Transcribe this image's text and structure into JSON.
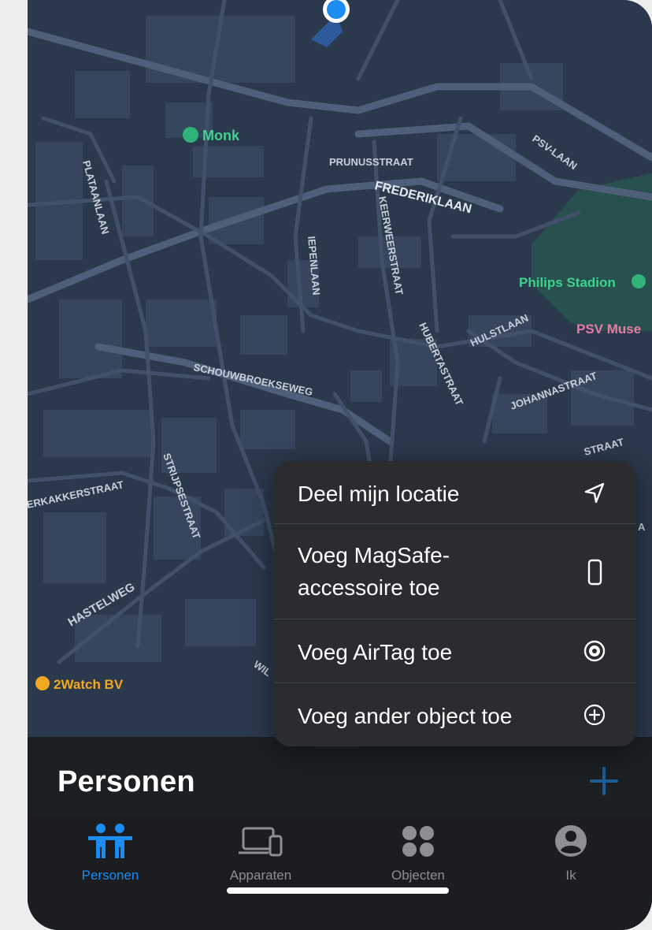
{
  "map": {
    "pois": {
      "monk": "Monk",
      "philips_stadion": "Philips Stadion",
      "psv_museum": "PSV Muse",
      "twowatch": "2Watch BV"
    },
    "streets": {
      "prunusstraat": "PRUNUSSTRAAT",
      "frederiklaan": "FREDERIKLAAN",
      "psv_laan": "PSV-LAAN",
      "plataanlaan": "PLATAANLAAN",
      "keerweerstraat": "KEERWEERSTRAAT",
      "iepenlaan": "IEPENLAAN",
      "hulstlaan": "HULSTLAAN",
      "hubertastraat": "HUBERTASTRAAT",
      "johannastraat": "JOHANNASTRAAT",
      "schouwbroekseweg": "SCHOUWBROEKSEWEG",
      "strijpsestraat": "STRIJPSESTRAAT",
      "akkerstraat": "ERKAKKERSTRAAT",
      "hastelweg": "HASTELWEG",
      "straat_right": "STRAAT",
      "wil": "WIL",
      "a_right": "A"
    }
  },
  "menu": {
    "items": [
      {
        "line1": "Deel mijn locatie",
        "line2": "",
        "icon": "location-arrow-icon"
      },
      {
        "line1": "Voeg MagSafe-",
        "line2": "accessoire toe",
        "icon": "phone-icon"
      },
      {
        "line1": "Voeg AirTag toe",
        "line2": "",
        "icon": "airtag-icon"
      },
      {
        "line1": "Voeg ander object toe",
        "line2": "",
        "icon": "plus-circle-icon"
      }
    ]
  },
  "sheet": {
    "title": "Personen"
  },
  "tabs": [
    {
      "label": "Personen",
      "active": true
    },
    {
      "label": "Apparaten",
      "active": false
    },
    {
      "label": "Objecten",
      "active": false
    },
    {
      "label": "Ik",
      "active": false
    }
  ],
  "colors": {
    "accent": "#1a8cf2",
    "map_bg": "#2c3a4e",
    "menu_bg": "#2a2c2f",
    "sheet_bg": "#1d2023"
  }
}
